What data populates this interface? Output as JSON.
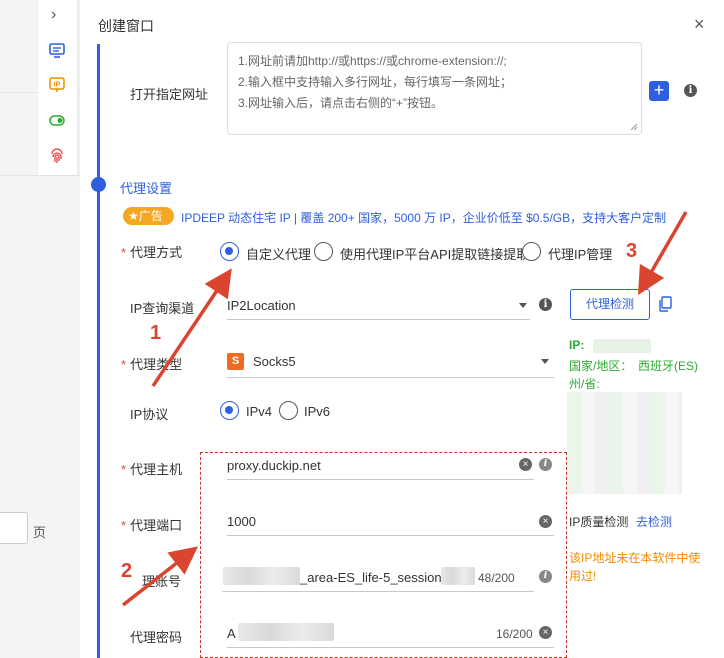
{
  "dialog": {
    "title": "创建窗口",
    "close_label": "×"
  },
  "sidebar": {
    "collapse_label": "›",
    "icons": [
      "monitor-icon",
      "ip-icon",
      "toggle-icon",
      "fingerprint-icon"
    ]
  },
  "background": {
    "pager_suffix": "页"
  },
  "open_url": {
    "label": "打开指定网址",
    "placeholder_lines": [
      "1.网址前请加http://或https://或chrome-extension://;",
      "2.输入框中支持输入多行网址，每行填写一条网址；",
      "3.网址输入后，请点击右侧的“+”按钮。"
    ],
    "add_label": "+"
  },
  "proxy": {
    "section_title": "代理设置",
    "ad_badge": "广告",
    "ad_text": "IPDEEP 动态住宅 IP | 覆盖 200+ 国家，5000 万 IP，企业价低至 $0.5/GB，支持大客户定制",
    "method": {
      "label": "代理方式",
      "options": [
        "自定义代理",
        "使用代理IP平台API提取链接提取",
        "代理IP管理"
      ],
      "selected": "自定义代理"
    },
    "ip_channel": {
      "label": "IP查询渠道",
      "value": "IP2Location"
    },
    "detect_label": "代理检测",
    "type": {
      "label": "代理类型",
      "value": "Socks5",
      "logo_letter": "S"
    },
    "protocol": {
      "label": "IP协议",
      "options": [
        "IPv4",
        "IPv6"
      ],
      "selected": "IPv4"
    },
    "host": {
      "label": "代理主机",
      "value": "proxy.duckip.net"
    },
    "port": {
      "label": "代理端口",
      "value": "1000"
    },
    "account": {
      "label": "理账号",
      "value_visible": "_area-ES_life-5_session-l",
      "counter": "48/200"
    },
    "password": {
      "label": "代理密码",
      "value_visible": "A",
      "counter": "16/200"
    }
  },
  "result": {
    "ip_label": "IP:",
    "country_label": "国家/地区：",
    "country_value": "西班牙(ES)",
    "province_label": "州/省:",
    "quality_label": "IP质量检测",
    "quality_link": "去检测",
    "note": "该IP地址未在本软件中使用过!"
  },
  "annotations": {
    "n1": "1",
    "n2": "2",
    "n3": "3",
    "arrow_color": "#d9452e"
  },
  "colors": {
    "accent": "#2e5fde",
    "required": "#e24040",
    "success": "#2eaa33",
    "warning": "#f08c00"
  }
}
